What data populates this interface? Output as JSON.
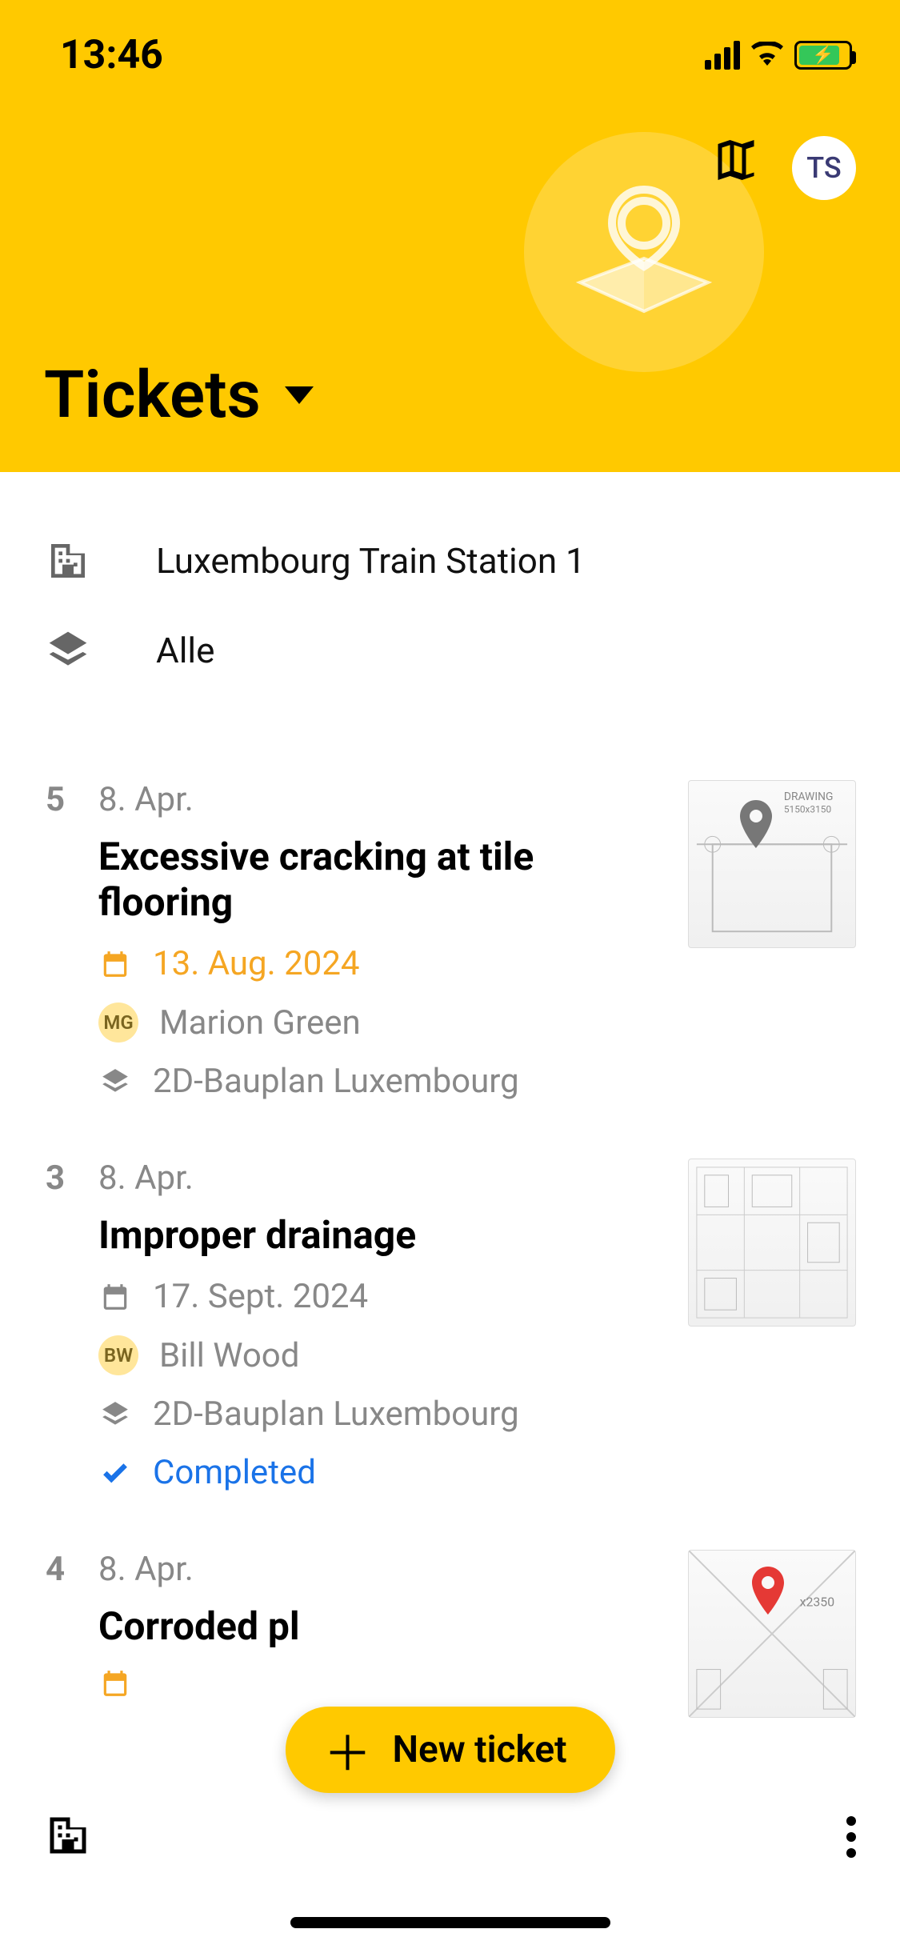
{
  "status_bar": {
    "time": "13:46"
  },
  "header": {
    "avatar_initials": "TS",
    "page_title": "Tickets"
  },
  "filters": {
    "project": "Luxembourg Train Station 1",
    "layer": "Alle"
  },
  "tickets": [
    {
      "number": "5",
      "short_date": "8. Apr.",
      "title": "Excessive cracking at tile flooring",
      "due_date": "13. Aug. 2024",
      "due_highlight": true,
      "assignee_initials": "MG",
      "assignee_name": "Marion Green",
      "plan": "2D-Bauplan Luxembourg",
      "status": null,
      "pin_color": "#777"
    },
    {
      "number": "3",
      "short_date": "8. Apr.",
      "title": "Improper drainage",
      "due_date": "17. Sept. 2024",
      "due_highlight": false,
      "assignee_initials": "BW",
      "assignee_name": "Bill Wood",
      "plan": "2D-Bauplan Luxembourg",
      "status": "Completed",
      "pin_color": null
    },
    {
      "number": "4",
      "short_date": "8. Apr.",
      "title": "Corroded pl",
      "due_date": "",
      "due_highlight": true,
      "assignee_initials": "",
      "assignee_name": "",
      "plan": "",
      "status": null,
      "pin_color": "#e53935"
    }
  ],
  "fab": {
    "label": "New ticket"
  }
}
